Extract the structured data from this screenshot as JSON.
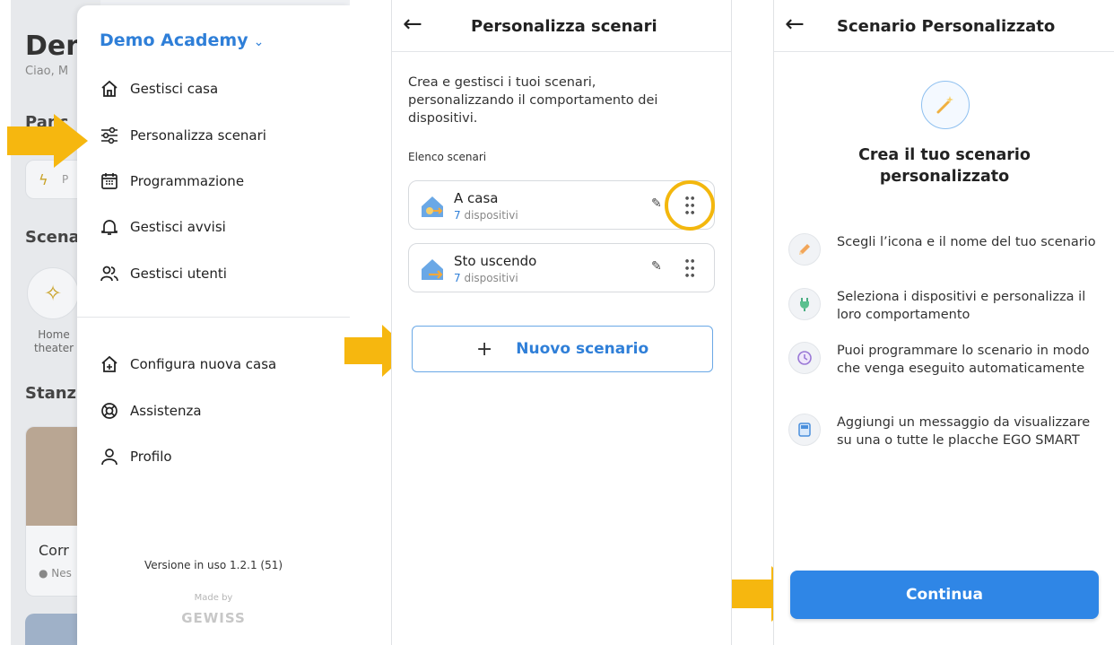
{
  "background_app": {
    "title_partial": "Den",
    "greeting_partial": "Ciao, M",
    "section_1_partial": "Panc",
    "section_2_partial": "Scena",
    "section_3_partial": "Stanz",
    "scenario_label": "Home theater",
    "room_name_partial": "Corr",
    "room_status_partial": "Nes"
  },
  "drawer": {
    "account_name": "Demo Academy",
    "menu_top": [
      {
        "label": "Gestisci casa",
        "icon": "home-icon"
      },
      {
        "label": "Personalizza scenari",
        "icon": "sliders-icon"
      },
      {
        "label": "Programmazione",
        "icon": "calendar-icon"
      },
      {
        "label": "Gestisci avvisi",
        "icon": "bell-icon"
      },
      {
        "label": "Gestisci utenti",
        "icon": "users-icon"
      }
    ],
    "menu_bottom": [
      {
        "label": "Configura nuova casa",
        "icon": "home-plus-icon"
      },
      {
        "label": "Assistenza",
        "icon": "lifebuoy-icon"
      },
      {
        "label": "Profilo",
        "icon": "user-icon"
      }
    ],
    "version": "Versione in uso 1.2.1 (51)",
    "made_by": "Made by",
    "brand": "GEWISS"
  },
  "scenari_screen": {
    "title": "Personalizza scenari",
    "description": "Crea e gestisci i tuoi scenari, personalizzando il comportamento dei dispositivi.",
    "list_label": "Elenco scenari",
    "scenarios": [
      {
        "name": "A casa",
        "count": "7",
        "count_unit": "dispositivi"
      },
      {
        "name": "Sto uscendo",
        "count": "7",
        "count_unit": "dispositivi"
      }
    ],
    "new_button_icon": "+",
    "new_button": "Nuovo scenario"
  },
  "custom_screen": {
    "title": "Scenario Personalizzato",
    "heading_line1": "Crea il tuo scenario",
    "heading_line2": "personalizzato",
    "features": [
      {
        "icon": "pencil-icon",
        "text": "Scegli l’icona e il nome del tuo scenario"
      },
      {
        "icon": "plug-icon",
        "text": "Seleziona i dispositivi e personalizza il loro comportamento"
      },
      {
        "icon": "clock-icon",
        "text": "Puoi programmare lo scenario in modo che venga eseguito automaticamente"
      },
      {
        "icon": "panel-icon",
        "text": "Aggiungi un messaggio da visualizzare su una o tutte le placche EGO SMART"
      }
    ],
    "continue_button": "Continua"
  },
  "colors": {
    "accent_blue": "#2f7fd8",
    "highlight_yellow": "#f3b70d"
  }
}
